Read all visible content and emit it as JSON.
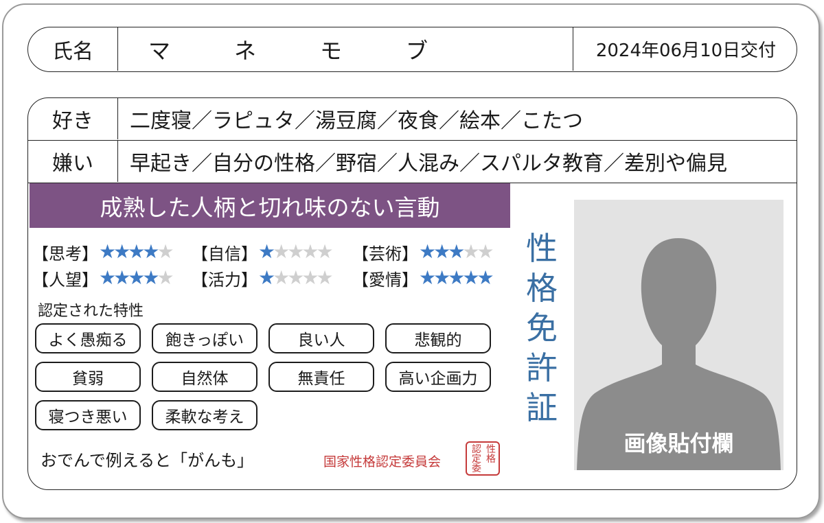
{
  "name_row": {
    "label": "氏名",
    "name_chars": [
      "マ",
      "ネ",
      "モ",
      "ブ"
    ],
    "issue_date": "2024年06月10日交付"
  },
  "likes": {
    "label": "好き",
    "value": "二度寝／ラピュタ／湯豆腐／夜食／絵本／こたつ"
  },
  "dislikes": {
    "label": "嫌い",
    "value": "早起き／自分の性格／野宿／人混み／スパルタ教育／差別や偏見"
  },
  "headline": "成熟した人柄と切れ味のない言動",
  "stats": [
    {
      "label": "【思考】",
      "rating": 4,
      "max": 5
    },
    {
      "label": "【自信】",
      "rating": 1,
      "max": 5
    },
    {
      "label": "【芸術】",
      "rating": 3,
      "max": 5
    },
    {
      "label": "【人望】",
      "rating": 4,
      "max": 5
    },
    {
      "label": "【活力】",
      "rating": 1,
      "max": 5
    },
    {
      "label": "【愛情】",
      "rating": 5,
      "max": 5
    }
  ],
  "traits_title": "認定された特性",
  "traits": [
    "よく愚痴る",
    "飽きっぽい",
    "良い人",
    "悲観的",
    "貧弱",
    "自然体",
    "無責任",
    "高い企画力",
    "寝つき悪い",
    "柔軟な考え"
  ],
  "oden": "おでんで例えると「がんも」",
  "committee": "国家性格認定委員会",
  "seal_cols": [
    "性格",
    "認定委"
  ],
  "vertical_title": [
    "性",
    "格",
    "免",
    "許",
    "証"
  ],
  "photo_label": "画像貼付欄",
  "colors": {
    "headline_bg": "#7d5384",
    "star_on": "#3d7ac4",
    "star_off": "#cfcfcf",
    "title_blue": "#3a6fa3",
    "seal_red": "#c53a3a"
  }
}
